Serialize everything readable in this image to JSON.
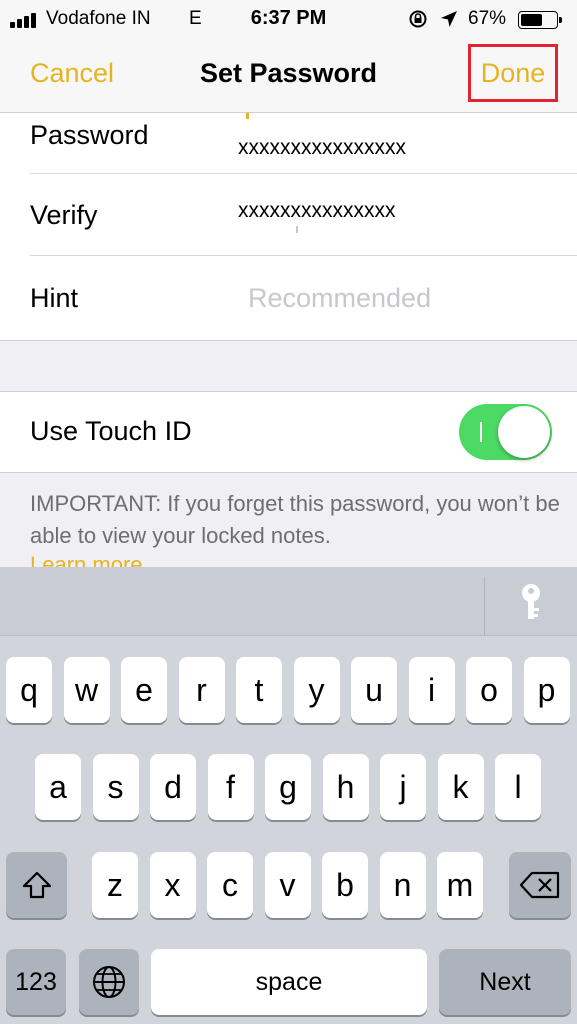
{
  "status_bar": {
    "carrier": "Vodafone IN",
    "network": "E",
    "time": "6:37 PM",
    "battery_percent": "67%",
    "battery_level": 0.67
  },
  "nav": {
    "cancel": "Cancel",
    "title": "Set Password",
    "done": "Done"
  },
  "form": {
    "password_label": "Password",
    "password_value": "xxxxxxxxxxxxxxxx",
    "verify_label": "Verify",
    "verify_value": "xxxxxxxxxxxxxxx",
    "hint_label": "Hint",
    "hint_placeholder": "Recommended",
    "touch_id_label": "Use Touch ID",
    "touch_id_enabled": true,
    "footnote": "IMPORTANT: If you forget this password, you won’t be able to view your locked notes.",
    "learn_more": "Learn more"
  },
  "keyboard": {
    "row1": [
      "q",
      "w",
      "e",
      "r",
      "t",
      "y",
      "u",
      "i",
      "o",
      "p"
    ],
    "row2": [
      "a",
      "s",
      "d",
      "f",
      "g",
      "h",
      "j",
      "k",
      "l"
    ],
    "row3": [
      "z",
      "x",
      "c",
      "v",
      "b",
      "n",
      "m"
    ],
    "numbers": "123",
    "space": "space",
    "next": "Next",
    "icons": [
      "key-icon",
      "shift-icon",
      "backspace-icon",
      "globe-icon"
    ]
  },
  "colors": {
    "accent": "#e6b420",
    "toggle_on": "#4cd964",
    "highlight_box": "#e32232"
  }
}
